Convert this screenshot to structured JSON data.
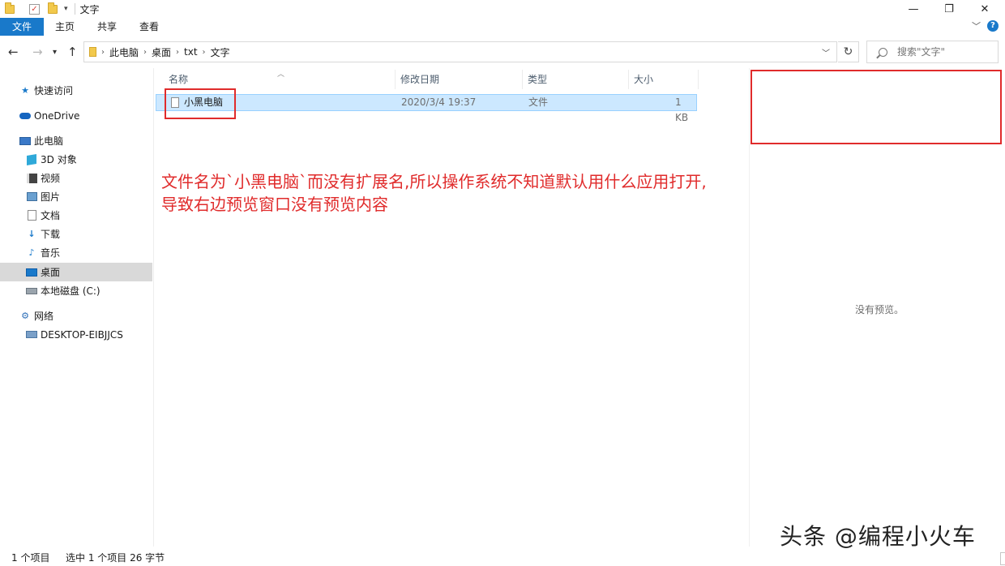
{
  "window": {
    "title": "文字",
    "controls": {
      "minimize": "—",
      "restore": "❐",
      "close": "✕"
    }
  },
  "ribbon": {
    "tabs": [
      "文件",
      "主页",
      "共享",
      "查看"
    ]
  },
  "address": {
    "crumbs": [
      "此电脑",
      "桌面",
      "txt",
      "文字"
    ],
    "search_placeholder": "搜索\"文字\""
  },
  "sidebar": {
    "items": [
      {
        "label": "快速访问",
        "icon": "star-icon"
      },
      {
        "label": "OneDrive",
        "icon": "cloud-icon"
      },
      {
        "label": "此电脑",
        "icon": "computer-icon"
      },
      {
        "label": "3D 对象",
        "icon": "cube-icon"
      },
      {
        "label": "视频",
        "icon": "video-icon"
      },
      {
        "label": "图片",
        "icon": "picture-icon"
      },
      {
        "label": "文档",
        "icon": "document-icon"
      },
      {
        "label": "下载",
        "icon": "download-icon"
      },
      {
        "label": "音乐",
        "icon": "music-icon"
      },
      {
        "label": "桌面",
        "icon": "desktop-icon",
        "selected": true
      },
      {
        "label": "本地磁盘 (C:)",
        "icon": "disk-icon"
      },
      {
        "label": "网络",
        "icon": "network-icon"
      },
      {
        "label": "DESKTOP-EIBJJCS",
        "icon": "host-icon"
      }
    ]
  },
  "filelist": {
    "columns": [
      "名称",
      "修改日期",
      "类型",
      "大小"
    ],
    "rows": [
      {
        "name": "小黑电脑",
        "modified": "2020/3/4 19:37",
        "type": "文件",
        "size": "1 KB"
      }
    ]
  },
  "annotation": {
    "line1": "文件名为`小黑电脑`而没有扩展名,所以操作系统不知道默认用什么应用打开,",
    "line2": "导致右边预览窗口没有预览内容"
  },
  "preview": {
    "message": "没有预览。"
  },
  "status": {
    "count": "1 个项目",
    "selection": "选中 1 个项目  26 字节"
  },
  "watermark": "头条 @编程小火车",
  "colors": {
    "accent": "#1979ca",
    "annotation": "#e02b2b",
    "selection": "#cce8ff"
  }
}
